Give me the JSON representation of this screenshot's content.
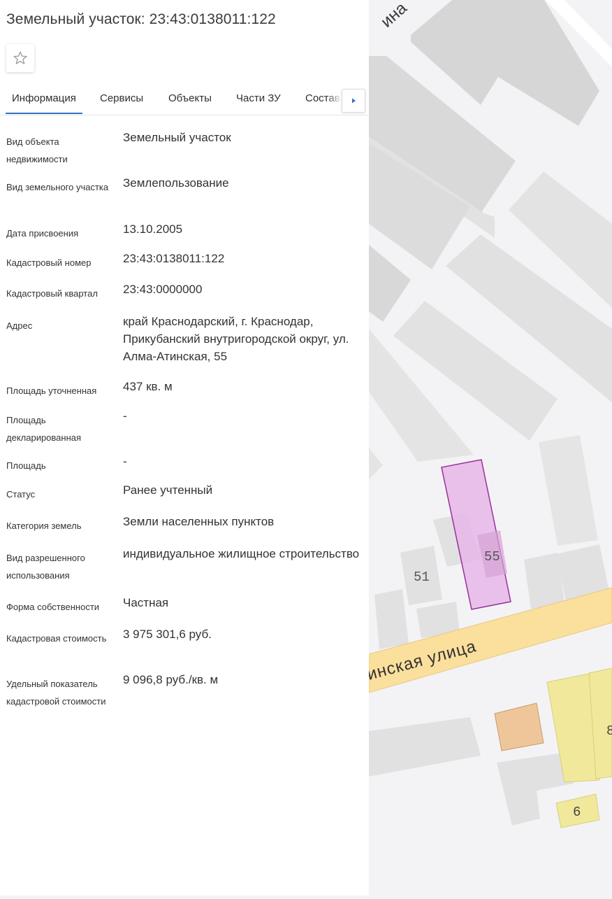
{
  "title": "Земельный участок: 23:43:0138011:122",
  "tabs": [
    "Информация",
    "Сервисы",
    "Объекты",
    "Части ЗУ",
    "Состав"
  ],
  "icons": {
    "favorite": "star-outline-icon",
    "tabs_next": "caret-right-icon"
  },
  "colors": {
    "tab_active": "#2f74c0",
    "tab_next_arrow": "#2f74c0",
    "parcel_fill": "#e5b6e6",
    "parcel_stroke": "#9b2f9b",
    "street": "#fbdf9c",
    "building": "#d9d9d9",
    "map_background": "#f3f3f6",
    "commercial": "#f1e89b",
    "orange_building": "#eec699"
  },
  "fields": [
    {
      "label": "Вид объекта недвижимости",
      "value": "Земельный участок"
    },
    {
      "label": "Вид земельного участка",
      "value": "Землепользование"
    },
    {
      "label": "Дата присвоения",
      "value": "13.10.2005"
    },
    {
      "label": "Кадастровый номер",
      "value": "23:43:0138011:122"
    },
    {
      "label": "Кадастровый квартал",
      "value": "23:43:0000000"
    },
    {
      "label": "Адрес",
      "value": "край Краснодарский, г. Краснодар, Прикубанский внутригородской округ, ул. Алма-Атинская, 55"
    },
    {
      "label": "Площадь уточненная",
      "value": "437 кв. м"
    },
    {
      "label": "Площадь декларированная",
      "value": "-"
    },
    {
      "label": "Площадь",
      "value": "-"
    },
    {
      "label": "Статус",
      "value": "Ранее учтенный"
    },
    {
      "label": "Категория земель",
      "value": "Земли населенных пунктов"
    },
    {
      "label": "Вид разрешенного использования",
      "value": "индивидуальное жилищное строительство"
    },
    {
      "label": "Форма собственности",
      "value": "Частная"
    },
    {
      "label": "Кадастровая стоимость",
      "value": "3 975 301,6 руб."
    },
    {
      "label": "Удельный показатель кадастровой стоимости",
      "value": "9 096,8 руб./кв. м"
    }
  ],
  "map": {
    "street_label": "инская улица",
    "top_street_label": "ина",
    "house_numbers": [
      "51",
      "55",
      "6",
      "8"
    ]
  }
}
